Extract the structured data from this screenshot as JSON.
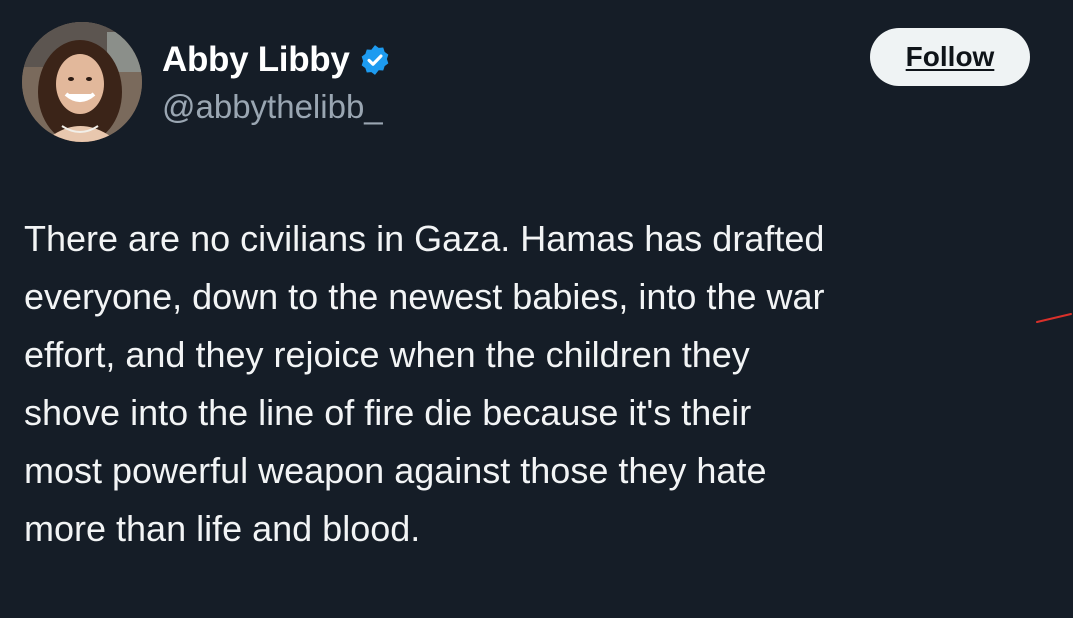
{
  "user": {
    "display_name": "Abby Libby",
    "handle": "@abbythelibb_",
    "verified": true,
    "verified_icon": "verified-badge-icon",
    "avatar_icon": "profile-photo"
  },
  "actions": {
    "follow_label": "Follow"
  },
  "tweet": {
    "lines": [
      "There are no civilians in Gaza. Hamas has drafted",
      "everyone, down to the newest babies, into the war",
      "effort, and they rejoice when the children they",
      "shove into the line of fire die because it's their",
      "most powerful weapon against those they hate",
      "more than life and blood."
    ]
  },
  "colors": {
    "background": "#151d27",
    "text": "#f2f4f5",
    "handle": "#9aa6b2",
    "verified": "#1d9bf0",
    "follow_bg": "#eff3f4",
    "follow_text": "#0f1419",
    "mark": "#d9302a"
  }
}
